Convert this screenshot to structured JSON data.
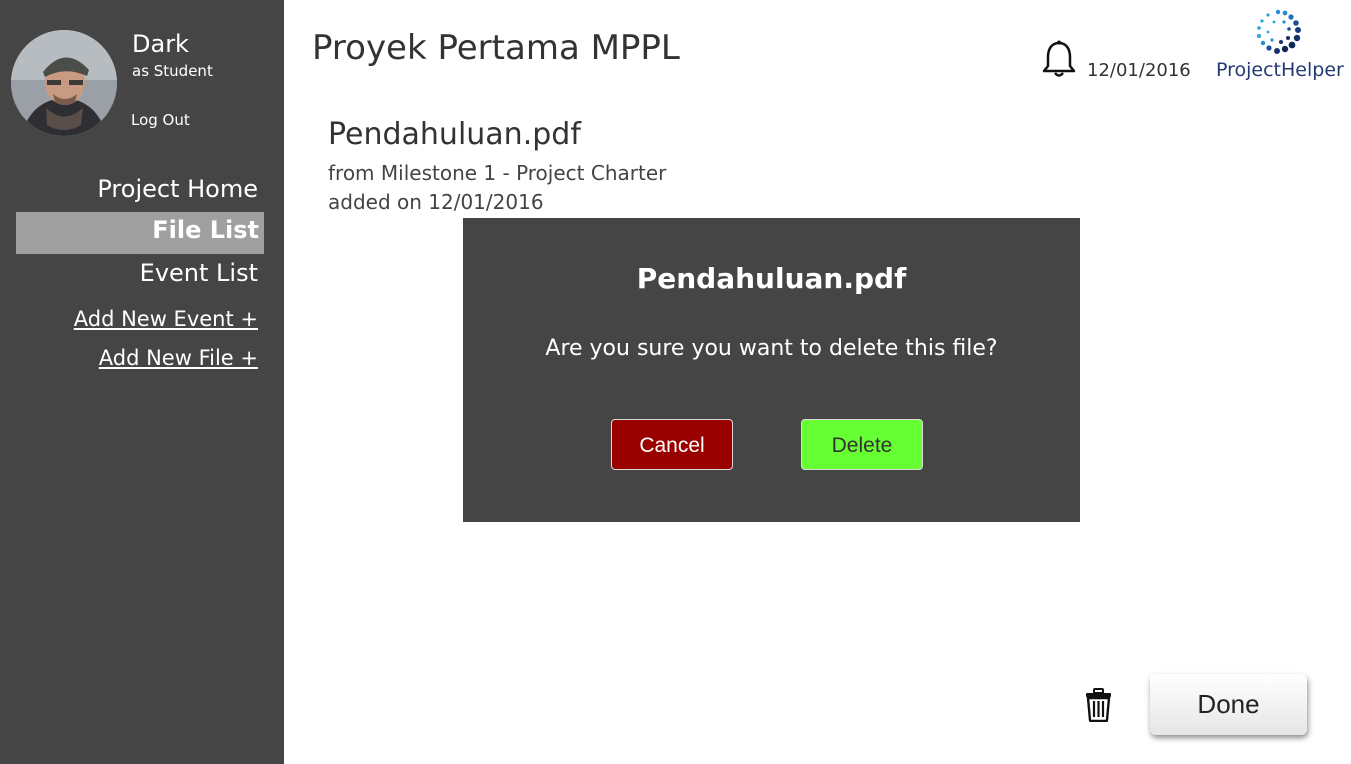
{
  "user": {
    "name": "Dark",
    "role": "as Student",
    "logout_label": "Log Out"
  },
  "sidebar": {
    "items": [
      {
        "label": "Project Home",
        "active": false
      },
      {
        "label": "File List",
        "active": true
      },
      {
        "label": "Event List",
        "active": false
      }
    ],
    "links": [
      {
        "label": "Add New Event +"
      },
      {
        "label": "Add New File +"
      }
    ]
  },
  "header": {
    "project_title": "Proyek Pertama MPPL",
    "date": "12/01/2016",
    "logo_text": "ProjectHelper",
    "notification_icon": "bell-icon"
  },
  "file": {
    "name": "Pendahuluan.pdf",
    "source": "from Milestone 1 - Project Charter",
    "added": "added on 12/01/2016"
  },
  "dialog": {
    "title": "Pendahuluan.pdf",
    "message": "Are you sure you want to delete this file?",
    "cancel_label": "Cancel",
    "delete_label": "Delete"
  },
  "footer": {
    "done_label": "Done",
    "trash_icon": "trash-icon"
  },
  "colors": {
    "sidebar_bg": "#454545",
    "active_item_bg": "#a0a0a0",
    "cancel_bg": "#990000",
    "delete_bg": "#66ff33",
    "logo_text": "#243a73"
  }
}
